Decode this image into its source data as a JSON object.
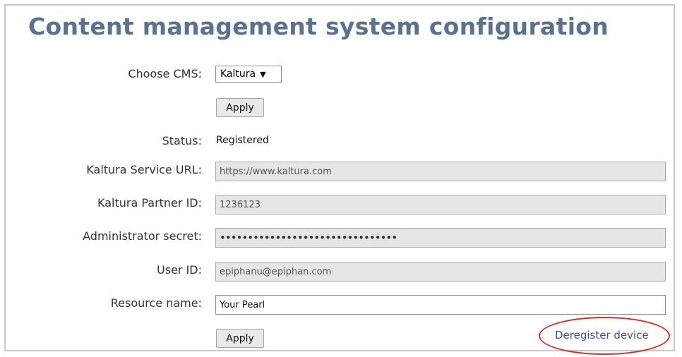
{
  "page": {
    "title": "Content management system configuration"
  },
  "form": {
    "choose_cms": {
      "label": "Choose CMS:",
      "selected": "Kaltura"
    },
    "apply_top": "Apply",
    "status": {
      "label": "Status:",
      "value": "Registered"
    },
    "service_url": {
      "label": "Kaltura Service URL:",
      "value": "https://www.kaltura.com"
    },
    "partner_id": {
      "label": "Kaltura Partner ID:",
      "value": "1236123"
    },
    "admin_secret": {
      "label": "Administrator secret:",
      "value": "••••••••••••••••••••••••••••••••"
    },
    "user_id": {
      "label": "User ID:",
      "value": "epiphanu@epiphan.com"
    },
    "resource_name": {
      "label": "Resource name:",
      "value": "Your Pearl"
    },
    "apply_bottom": "Apply",
    "deregister": "Deregister device"
  },
  "colors": {
    "title": "#5a7190",
    "link": "#3d4fa0",
    "annotation": "#d9302c",
    "readonly_field": "#e6e6e4"
  }
}
